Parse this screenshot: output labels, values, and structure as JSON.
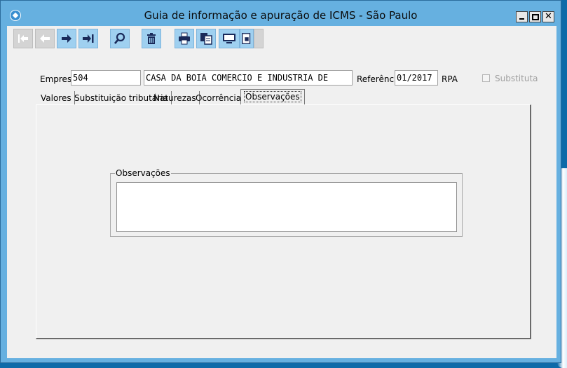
{
  "window": {
    "title": "Guia de informação e apuração de ICMS - São Paulo",
    "close_glyph": "✕"
  },
  "toolbar": {
    "buttons": [
      {
        "name": "first-record-icon",
        "enabled": false
      },
      {
        "name": "previous-record-icon",
        "enabled": false
      },
      {
        "name": "next-record-icon",
        "enabled": true
      },
      {
        "name": "last-record-icon",
        "enabled": true
      },
      {
        "name": "search-icon",
        "enabled": true
      },
      {
        "name": "delete-icon",
        "enabled": true
      },
      {
        "name": "print-icon",
        "enabled": true
      },
      {
        "name": "copy-icon",
        "enabled": true
      },
      {
        "name": "screen-preview-icon",
        "enabled": true
      },
      {
        "name": "export-document-icon",
        "enabled": true
      }
    ]
  },
  "form": {
    "empresa_label": "Empresa",
    "empresa_code": "504",
    "empresa_name": "CASA DA BOIA COMERCIO E INDUSTRIA DE",
    "referencia_label": "Referência",
    "referencia_value": "01/2017",
    "rpa_label": "RPA",
    "substituta_label": "Substituta",
    "substituta_checked": false
  },
  "tabs": [
    {
      "label": "Valores"
    },
    {
      "label": "Substituição tributária"
    },
    {
      "label": "Naturezas"
    },
    {
      "label": "Ocorrências"
    },
    {
      "label": "Observações",
      "active": true
    }
  ],
  "observacoes": {
    "group_label": "Observações",
    "text": ""
  }
}
